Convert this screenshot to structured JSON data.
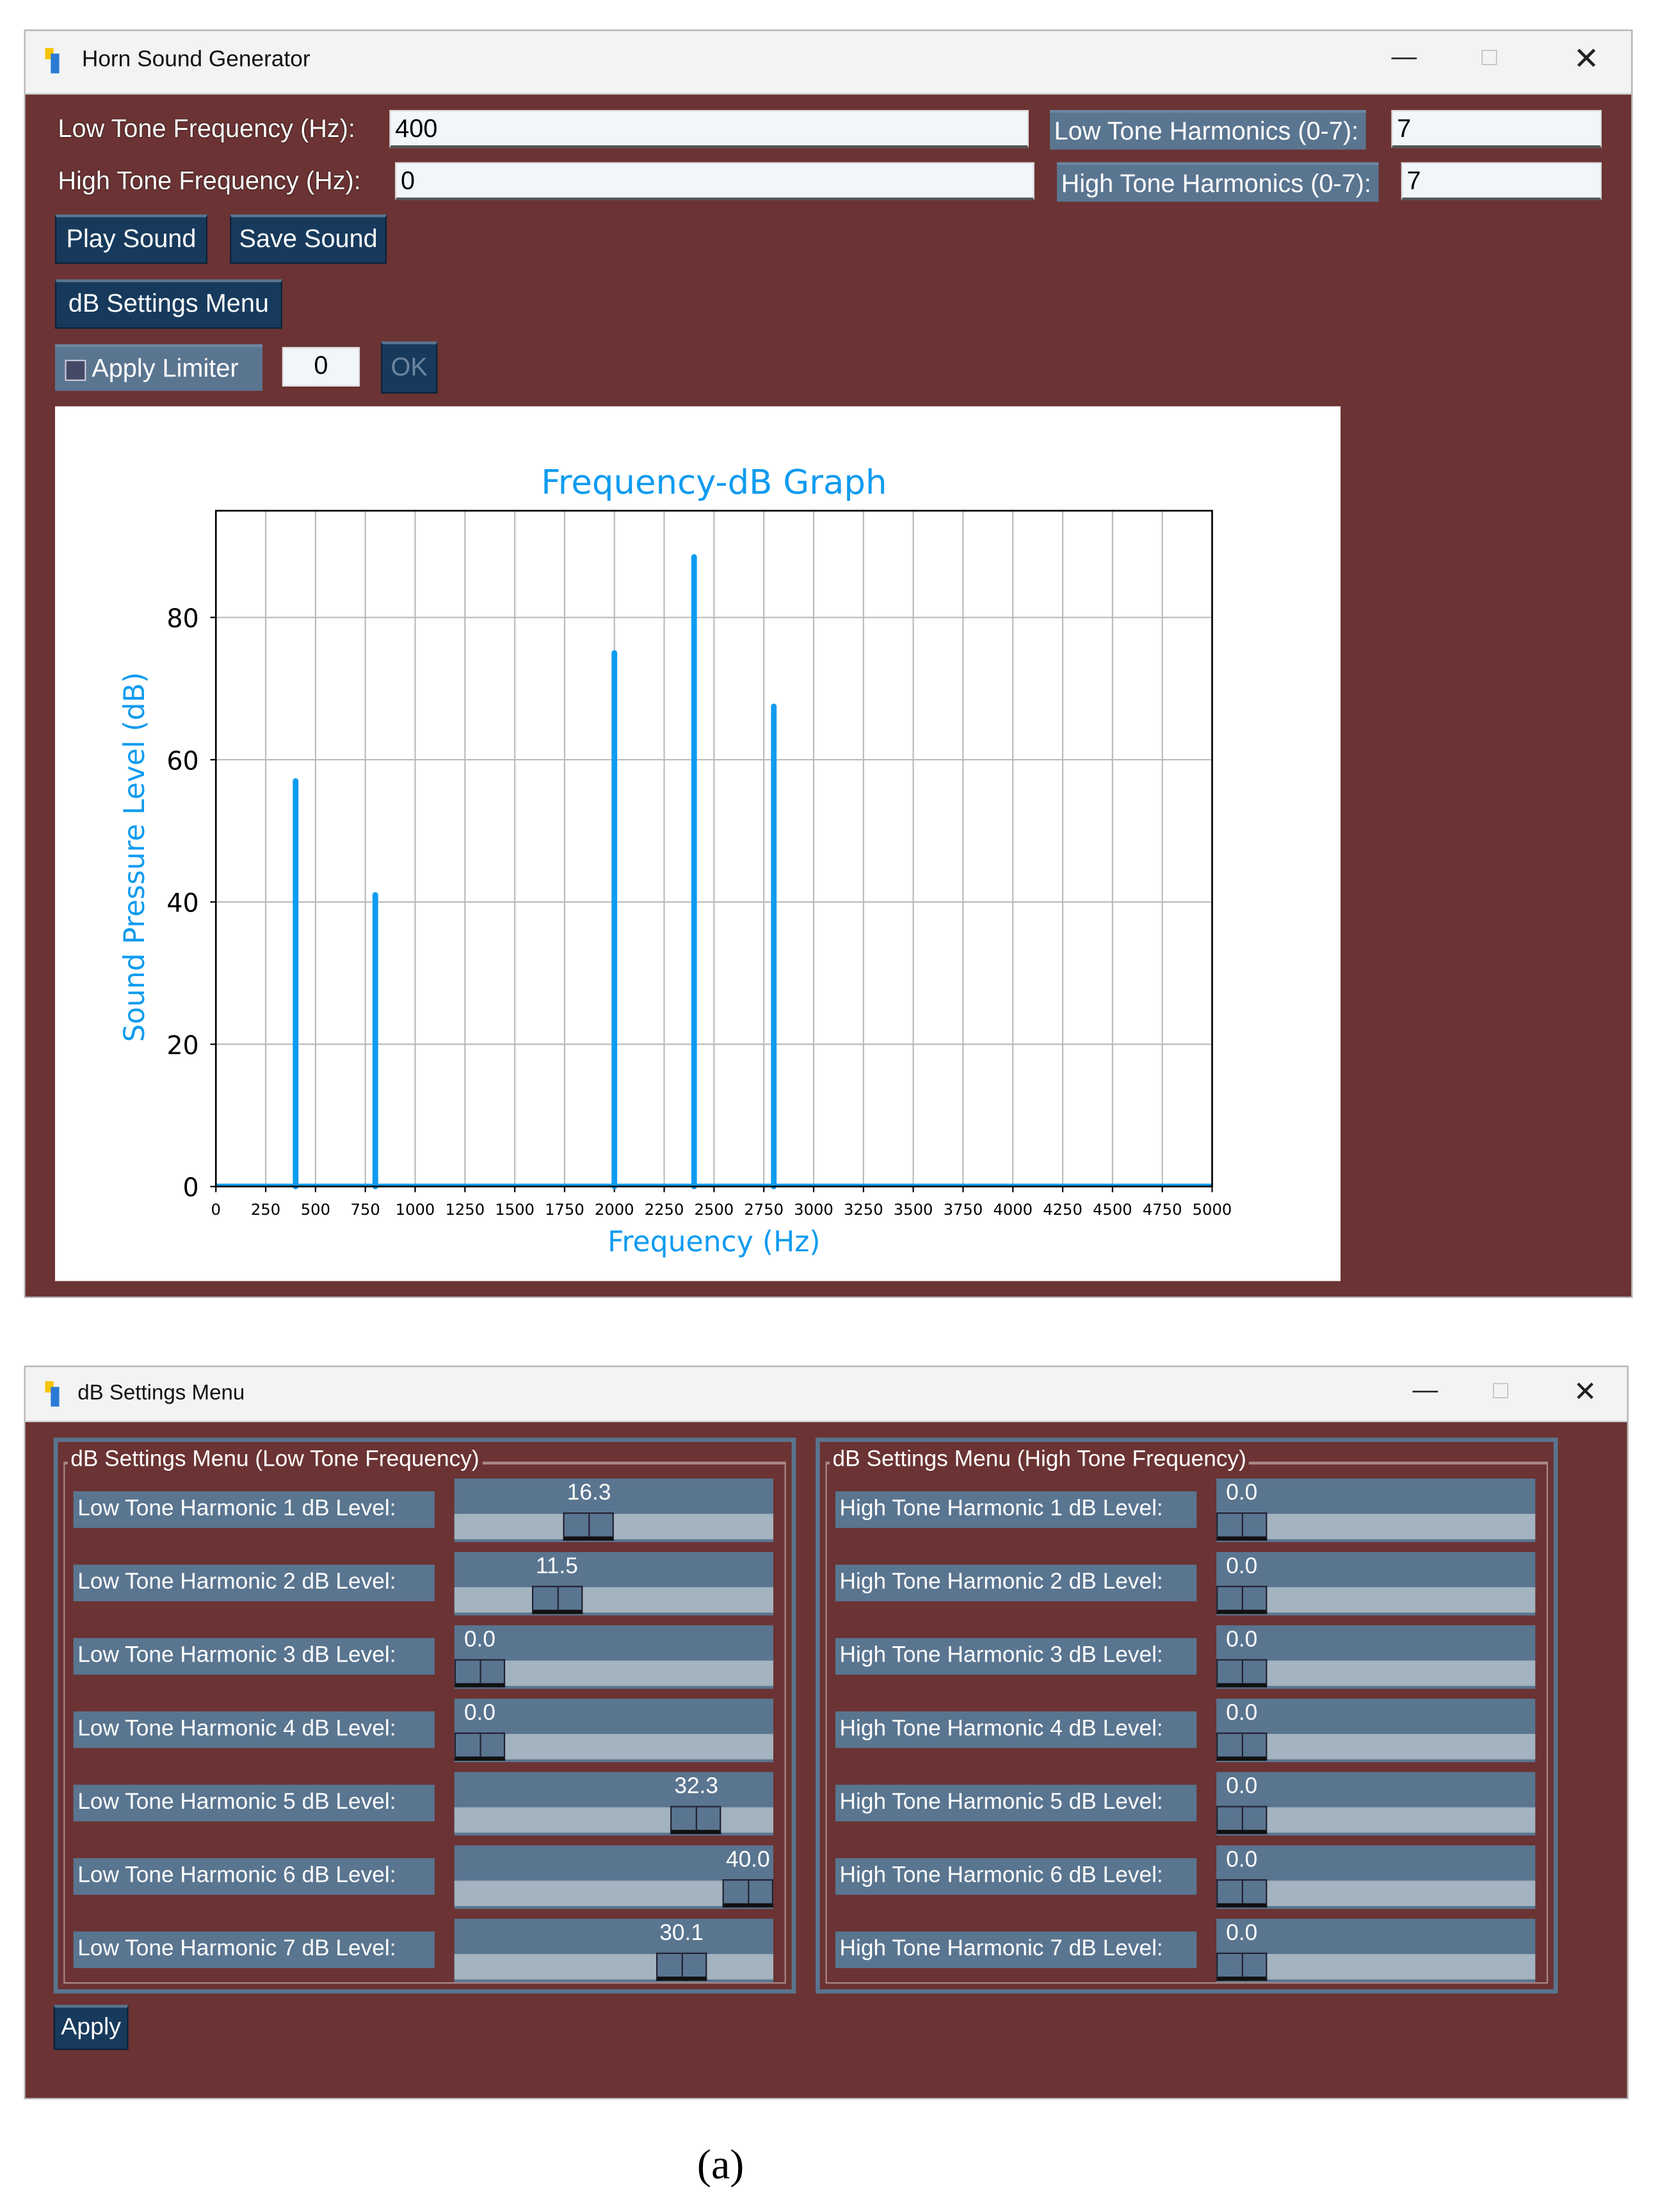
{
  "main_window": {
    "title": "Horn Sound Generator",
    "low_freq_label": "Low Tone Frequency (Hz):",
    "low_freq_value": "400",
    "high_freq_label": "High Tone Frequency (Hz):",
    "high_freq_value": "0",
    "low_harm_label": "Low Tone Harmonics (0-7):",
    "low_harm_value": "7",
    "high_harm_label": "High Tone Harmonics (0-7):",
    "high_harm_value": "7",
    "play_label": "Play Sound",
    "save_label": "Save Sound",
    "db_menu_label": "dB Settings Menu",
    "limiter_label": "Apply Limiter",
    "limiter_checked": false,
    "limiter_value": "0",
    "ok_label": "OK"
  },
  "chart_data": {
    "type": "bar",
    "title": "Frequency-dB Graph",
    "xlabel": "Frequency (Hz)",
    "ylabel": "Sound Pressure Level (dB)",
    "xlim": [
      0,
      5000
    ],
    "ylim": [
      0,
      95
    ],
    "xticks": [
      0,
      250,
      500,
      750,
      1000,
      1250,
      1500,
      1750,
      2000,
      2250,
      2500,
      2750,
      3000,
      3250,
      3500,
      3750,
      4000,
      4250,
      4500,
      4750,
      5000
    ],
    "yticks": [
      0,
      20,
      40,
      60,
      80
    ],
    "grid": true,
    "color": "#0f9bf0",
    "x": [
      400,
      800,
      2000,
      2400,
      2800
    ],
    "values": [
      57,
      41,
      75,
      88.5,
      67.5
    ]
  },
  "db_window": {
    "title": "dB Settings Menu",
    "low_group_label": "dB Settings Menu (Low Tone Frequency)",
    "high_group_label": "dB Settings Menu (High Tone Frequency)",
    "slider_max": 40,
    "low_rows": [
      {
        "label": "Low Tone Harmonic 1 dB Level:",
        "value": "16.3"
      },
      {
        "label": "Low Tone Harmonic 2 dB Level:",
        "value": "11.5"
      },
      {
        "label": "Low Tone Harmonic 3 dB Level:",
        "value": "0.0"
      },
      {
        "label": "Low Tone Harmonic 4 dB Level:",
        "value": "0.0"
      },
      {
        "label": "Low Tone Harmonic 5 dB Level:",
        "value": "32.3"
      },
      {
        "label": "Low Tone Harmonic 6 dB Level:",
        "value": "40.0"
      },
      {
        "label": "Low Tone Harmonic 7 dB Level:",
        "value": "30.1"
      }
    ],
    "high_rows": [
      {
        "label": "High Tone Harmonic 1 dB Level:",
        "value": "0.0"
      },
      {
        "label": "High Tone Harmonic 2 dB Level:",
        "value": "0.0"
      },
      {
        "label": "High Tone Harmonic 3 dB Level:",
        "value": "0.0"
      },
      {
        "label": "High Tone Harmonic 4 dB Level:",
        "value": "0.0"
      },
      {
        "label": "High Tone Harmonic 5 dB Level:",
        "value": "0.0"
      },
      {
        "label": "High Tone Harmonic 6 dB Level:",
        "value": "0.0"
      },
      {
        "label": "High Tone Harmonic 7 dB Level:",
        "value": "0.0"
      }
    ],
    "apply_label": "Apply"
  },
  "caption": "(a)"
}
